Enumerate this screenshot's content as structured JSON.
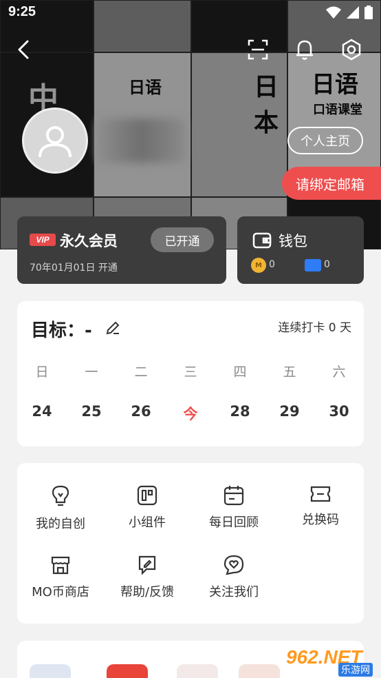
{
  "status_bar": {
    "time": "9:25"
  },
  "profile": {
    "homepage_label": "个人主页",
    "bind_email_label": "请绑定邮箱"
  },
  "vip": {
    "badge": "VIP",
    "title": "永久会员",
    "status": "已开通",
    "date": "70年01月01日 开通"
  },
  "wallet": {
    "title": "钱包",
    "coins": "0",
    "tickets": "0",
    "coin_symbol": "M"
  },
  "goal": {
    "label": "目标：-",
    "streak": "连续打卡 0 天",
    "weekdays": [
      "日",
      "一",
      "二",
      "三",
      "四",
      "五",
      "六"
    ],
    "dates": [
      "24",
      "25",
      "26",
      "今",
      "28",
      "29",
      "30"
    ],
    "today_color": "#ef4e4e"
  },
  "tools": [
    {
      "label": "我的自创",
      "icon": "lightbulb-icon"
    },
    {
      "label": "小组件",
      "icon": "widget-icon"
    },
    {
      "label": "每日回顾",
      "icon": "calendar-icon"
    },
    {
      "label": "兑换码",
      "icon": "ticket-icon"
    },
    {
      "label": "MO币商店",
      "icon": "shop-icon"
    },
    {
      "label": "帮助/反馈",
      "icon": "feedback-icon"
    },
    {
      "label": "关注我们",
      "icon": "heart-chat-icon"
    }
  ],
  "hero_text": {
    "t1": "日语",
    "t2": "中",
    "t3": "日本",
    "t4": "日语",
    "t5": "口语课堂"
  },
  "watermark": {
    "logo": "962.NET",
    "sub": "乐游网"
  },
  "colors": {
    "accent": "#ef4e4e",
    "card_dark": "#3c3c3c"
  }
}
